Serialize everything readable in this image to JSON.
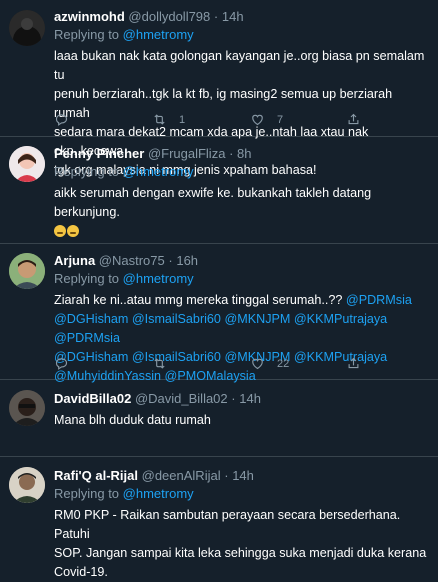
{
  "tweets": [
    {
      "name": "azwinmohd",
      "handle": "@dollydoll798",
      "time": "14h",
      "reply_prefix": "Replying to ",
      "reply_to": "@hmetromy",
      "lines": [
        "laaa bukan nak kata golongan kayangan je..org biasa pn semalam tu",
        "penuh berziarah..tgk la kt fb, ig masing2 semua up berziarah rumah",
        "sedara mara dekat2 mcam xda apa je..ntah laa xtau nak ckp..kecewa",
        "tgk org malaysia ni mmg jenis xpaham bahasa!"
      ],
      "retweets": "1",
      "likes": "7"
    },
    {
      "name": "Penny Pincher",
      "handle": "@FrugalFliza",
      "time": "8h",
      "reply_prefix": "Replying to ",
      "reply_to": "@hmetromy",
      "lines": [
        "aikk serumah dengan exwife ke. bukankah takleh datang berkunjung."
      ]
    },
    {
      "name": "Arjuna",
      "handle": "@Nastro75",
      "time": "16h",
      "reply_prefix": "Replying to ",
      "reply_to": "@hmetromy",
      "line1_text": "Ziarah ke ni..atau mmg mereka tinggal serumah..?? ",
      "line1_mention": "@PDRMsia",
      "line2": "@DGHisham @IsmailSabri60 @MKNJPM @KKMPutrajaya @PDRMsia",
      "line3": "@DGHisham @IsmailSabri60 @MKNJPM @KKMPutrajaya",
      "line4": "@MuhyiddinYassin @PMOMalaysia",
      "likes": "22"
    },
    {
      "name": "DavidBilla02",
      "handle": "@David_Billa02",
      "time": "14h",
      "lines": [
        "Mana blh duduk datu rumah"
      ]
    },
    {
      "name": "Rafi'Q al-Rijal",
      "handle": "@deenAlRijal",
      "time": "14h",
      "reply_prefix": "Replying to ",
      "reply_to": "@hmetromy",
      "lines": [
        "RM0 PKP - Raikan sambutan perayaan secara bersederhana. Patuhi",
        "SOP. Jangan sampai kita leka sehingga suka menjadi duka kerana",
        "Covid-19."
      ]
    }
  ],
  "separator": "·",
  "colors": {
    "background": "#15202b",
    "accent": "#1da1f2",
    "muted": "#8899a6"
  },
  "icons": [
    "reply-icon",
    "retweet-icon",
    "like-icon",
    "share-icon"
  ]
}
